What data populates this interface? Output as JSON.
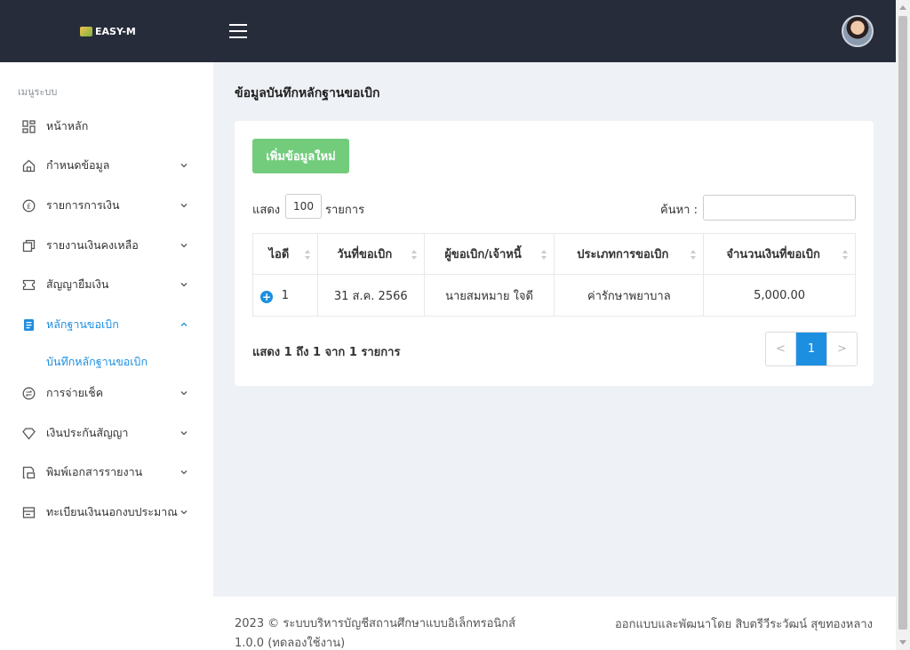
{
  "app": {
    "logo_text": "EASY-M",
    "brand_colors": {
      "topbar": "#272c3b",
      "accent": "#1d8fe1",
      "add_button": "#72cc7c"
    }
  },
  "sidebar": {
    "heading": "เมนูระบบ",
    "items": [
      {
        "label": "หน้าหลัก",
        "icon": "dashboard-icon",
        "has_children": false
      },
      {
        "label": "กำหนดข้อมูล",
        "icon": "home-icon",
        "has_children": true
      },
      {
        "label": "รายการการเงิน",
        "icon": "pound-coin-icon",
        "has_children": true
      },
      {
        "label": "รายงานเงินคงเหลือ",
        "icon": "copy-icon",
        "has_children": true
      },
      {
        "label": "สัญญายืมเงิน",
        "icon": "ticket-icon",
        "has_children": true
      },
      {
        "label": "หลักฐานขอเบิก",
        "icon": "document-icon",
        "has_children": true,
        "active": true,
        "expanded": true
      },
      {
        "label": "การจ่ายเช็ค",
        "icon": "exchange-icon",
        "has_children": true
      },
      {
        "label": "เงินประกันสัญญา",
        "icon": "diamond-icon",
        "has_children": true
      },
      {
        "label": "พิมพ์เอกสารรายงาน",
        "icon": "print-icon",
        "has_children": true
      },
      {
        "label": "ทะเบียนเงินนอกงบประมาณ",
        "icon": "inbox-icon",
        "has_children": true
      }
    ],
    "sub_item": "บันทึกหลักฐานขอเบิก"
  },
  "main": {
    "title": "ข้อมูลบันทึกหลักฐานขอเบิก",
    "add_button": "เพิ่มข้อมูลใหม่",
    "length_prefix": "แสดง",
    "length_value": "100",
    "length_suffix": "รายการ",
    "search_label": "ค้นหา :",
    "search_value": "",
    "table": {
      "columns": [
        "ไอดี",
        "วันที่ขอเบิก",
        "ผู้ขอเบิก/เจ้าหนี้",
        "ประเภทการขอเบิก",
        "จำนวนเงินที่ขอเบิก"
      ],
      "rows": [
        [
          "1",
          "31 ส.ค. 2566",
          "นายสมหมาย ใจดี",
          "ค่ารักษาพยาบาล",
          "5,000.00"
        ]
      ]
    },
    "info": "แสดง 1 ถึง 1 จาก 1 รายการ",
    "pager": {
      "prev": "<",
      "current": "1",
      "next": ">"
    }
  },
  "footer": {
    "copyright": "2023 © ระบบบริหารบัญชีสถานศึกษาแบบอิเล็กทรอนิกส์",
    "version": "1.0.0 (ทดลองใช้งาน)",
    "credit": "ออกแบบและพัฒนาโดย สิบตรีวีระวัฒน์ สุขทองหลาง"
  }
}
